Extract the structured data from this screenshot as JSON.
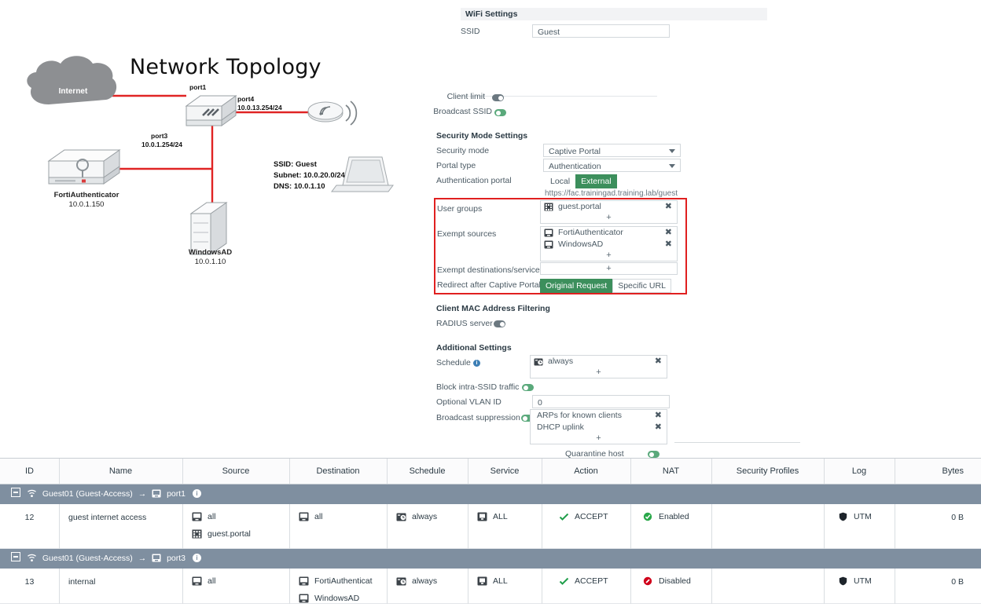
{
  "topology": {
    "title": "Network Topology",
    "cloud": {
      "label": "Internet"
    },
    "fortigate": {
      "port1": "port1",
      "port4_name": "port4",
      "port4_ip": "10.0.13.254/24",
      "port3_name": "port3",
      "port3_ip": "10.0.1.254/24"
    },
    "fortiauthenticator": {
      "name": "FortiAuthenticator",
      "ip": "10.0.1.150"
    },
    "windowsad": {
      "name": "WindowsAD",
      "ip": "10.0.1.10"
    },
    "wifi_info": {
      "ssid": "SSID:  Guest",
      "subnet": "Subnet:  10.0.20.0/24",
      "dns": "DNS:  10.0.1.10"
    }
  },
  "settings": {
    "wifi_section": {
      "title": "WiFi Settings"
    },
    "ssid": {
      "label": "SSID",
      "value": "Guest"
    },
    "client_limit": {
      "label": "Client limit",
      "state": "off"
    },
    "broadcast_ssid": {
      "label": "Broadcast SSID",
      "state": "on"
    },
    "security_section": {
      "title": "Security Mode Settings"
    },
    "security_mode": {
      "label": "Security mode",
      "value": "Captive Portal"
    },
    "portal_type": {
      "label": "Portal type",
      "value": "Authentication"
    },
    "auth_portal": {
      "label": "Authentication portal",
      "option_local": "Local",
      "option_external": "External",
      "selected": "External",
      "url": "https://fac.trainingad.training.lab/guest"
    },
    "user_groups": {
      "label": "User groups",
      "items": [
        {
          "name": "guest.portal",
          "icon": "user-group-icon"
        }
      ],
      "add": "+"
    },
    "exempt_sources": {
      "label": "Exempt sources",
      "items": [
        {
          "name": "FortiAuthenticator",
          "icon": "address-object-icon"
        },
        {
          "name": "WindowsAD",
          "icon": "address-object-icon"
        }
      ],
      "add": "+"
    },
    "exempt_destinations": {
      "label": "Exempt destinations/services",
      "items": [],
      "add": "+"
    },
    "redirect": {
      "label": "Redirect after Captive Portal",
      "option_original": "Original Request",
      "option_specific": "Specific URL",
      "selected": "Original Request"
    },
    "mac_filter_section": {
      "title": "Client MAC Address Filtering"
    },
    "radius_server": {
      "label": "RADIUS server",
      "state": "off"
    },
    "additional_section": {
      "title": "Additional Settings"
    },
    "schedule": {
      "label": "Schedule",
      "items": [
        {
          "name": "always",
          "icon": "schedule-icon"
        }
      ],
      "add": "+"
    },
    "block_intra_ssid": {
      "label": "Block intra-SSID traffic",
      "state": "on"
    },
    "optional_vlan": {
      "label": "Optional VLAN ID",
      "value": "0"
    },
    "broadcast_suppression": {
      "label": "Broadcast suppression",
      "state": "on",
      "items": [
        {
          "name": "ARPs for known clients"
        },
        {
          "name": "DHCP uplink"
        }
      ],
      "add": "+"
    },
    "quarantine_host": {
      "label": "Quarantine host",
      "state": "on"
    },
    "highlight_color": "#e02020",
    "accent_green": "#3c8f5c"
  },
  "policy_table": {
    "columns": [
      "ID",
      "Name",
      "Source",
      "Destination",
      "Schedule",
      "Service",
      "Action",
      "NAT",
      "Security Profiles",
      "Log",
      "Bytes"
    ],
    "groups": [
      {
        "label": "Guest01 (Guest-Access)",
        "arrow": "→",
        "interface": "port1",
        "count": "1",
        "rows": [
          {
            "id": "12",
            "name": "guest internet access",
            "source": [
              {
                "text": "all",
                "icon": "address-icon"
              },
              {
                "text": "guest.portal",
                "icon": "user-group-icon"
              }
            ],
            "destination": [
              {
                "text": "all",
                "icon": "address-icon"
              }
            ],
            "schedule": {
              "text": "always",
              "icon": "schedule-icon"
            },
            "service": {
              "text": "ALL",
              "icon": "service-icon"
            },
            "action": {
              "text": "ACCEPT",
              "icon": "check-icon"
            },
            "nat": {
              "text": "Enabled",
              "icon": "enabled-icon"
            },
            "security_profiles": "",
            "log": {
              "text": "UTM",
              "icon": "shield-icon"
            },
            "bytes": "0 B"
          }
        ]
      },
      {
        "label": "Guest01 (Guest-Access)",
        "arrow": "→",
        "interface": "port3",
        "count": "1",
        "rows": [
          {
            "id": "13",
            "name": "internal",
            "source": [
              {
                "text": "all",
                "icon": "address-icon"
              }
            ],
            "destination": [
              {
                "text": "FortiAuthenticat",
                "icon": "address-icon"
              },
              {
                "text": "WindowsAD",
                "icon": "address-icon"
              }
            ],
            "schedule": {
              "text": "always",
              "icon": "schedule-icon"
            },
            "service": {
              "text": "ALL",
              "icon": "service-icon"
            },
            "action": {
              "text": "ACCEPT",
              "icon": "check-icon"
            },
            "nat": {
              "text": "Disabled",
              "icon": "disabled-icon"
            },
            "security_profiles": "",
            "log": {
              "text": "UTM",
              "icon": "shield-icon"
            },
            "bytes": "0 B"
          }
        ]
      }
    ]
  }
}
